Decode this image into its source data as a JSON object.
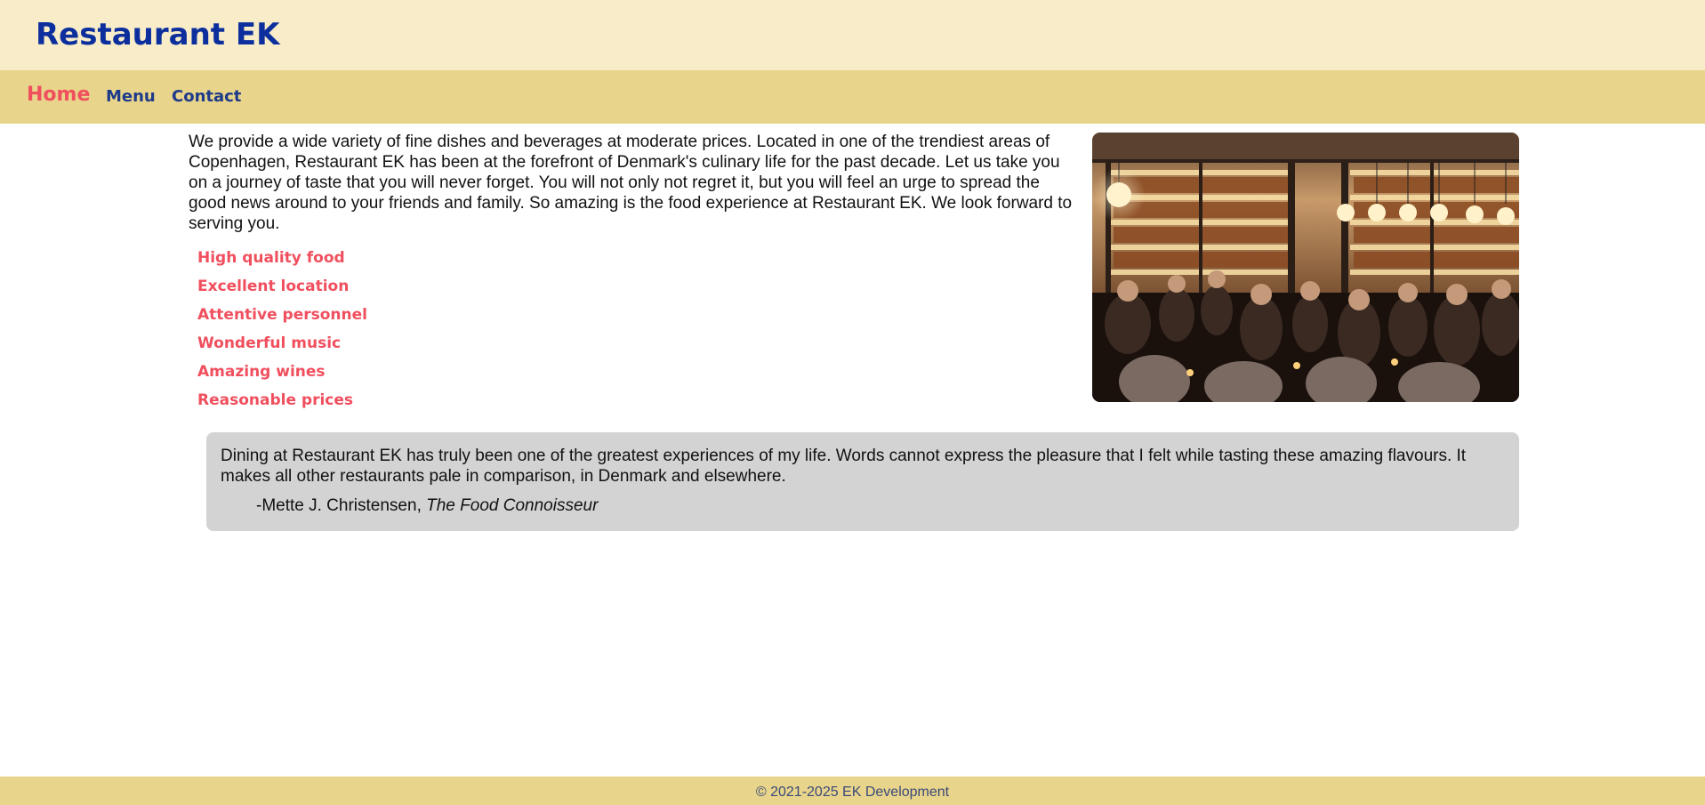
{
  "header": {
    "title": "Restaurant EK"
  },
  "nav": {
    "items": [
      {
        "label": "Home",
        "active": true
      },
      {
        "label": "Menu",
        "active": false
      },
      {
        "label": "Contact",
        "active": false
      }
    ]
  },
  "main": {
    "intro": "We provide a wide variety of fine dishes and beverages at moderate prices. Located in one of the trendiest areas of Copenhagen, Restaurant EK has been at the forefront of Denmark's culinary life for the past decade. Let us take you on a journey of taste that you will never forget. You will not only not regret it, but you will feel an urge to spread the good news around to your friends and family. So amazing is the food experience at Restaurant EK. We look forward to serving you.",
    "features": [
      "High quality food",
      "Excellent location",
      "Attentive personnel",
      "Wonderful music",
      "Amazing wines",
      "Reasonable prices"
    ]
  },
  "testimonial": {
    "text": "Dining at Restaurant EK has truly been one of the greatest experiences of my life. Words cannot express the pleasure that I felt while tasting these amazing flavours. It makes all other restaurants pale in comparison, in Denmark and elsewhere.",
    "author": "-Mette J. Christensen,",
    "source": "The Food Connoisseur"
  },
  "footer": {
    "copyright": "© 2021-2025 EK Development"
  },
  "colors": {
    "header_bg": "#F8EDC8",
    "nav_bg": "#E8D48A",
    "brand": "#0D2F9E",
    "accent": "#F04F5E",
    "nav_link": "#1E3A8A",
    "quote_bg": "#D3D3D3"
  }
}
